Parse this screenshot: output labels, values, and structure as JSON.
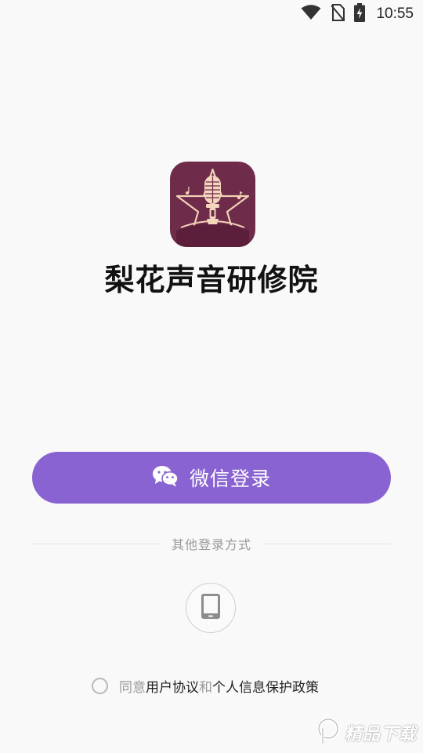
{
  "status_bar": {
    "time": "10:55",
    "icons": [
      "wifi-icon",
      "no-sim-icon",
      "battery-charging-icon"
    ]
  },
  "app": {
    "title": "梨花声音研修院",
    "logo_icon": "microphone-star-logo",
    "logo_color": "#6f2b4a"
  },
  "wechat_login": {
    "label": "微信登录",
    "icon": "wechat-icon",
    "color": "#8a63d2"
  },
  "other_login": {
    "divider_text": "其他登录方式",
    "phone_icon": "phone-icon"
  },
  "agreement": {
    "prefix": "同意",
    "user_agreement": "用户协议",
    "conjunction": "和",
    "privacy_policy": "个人信息保护政策"
  },
  "watermark": {
    "text": "精品下载"
  }
}
